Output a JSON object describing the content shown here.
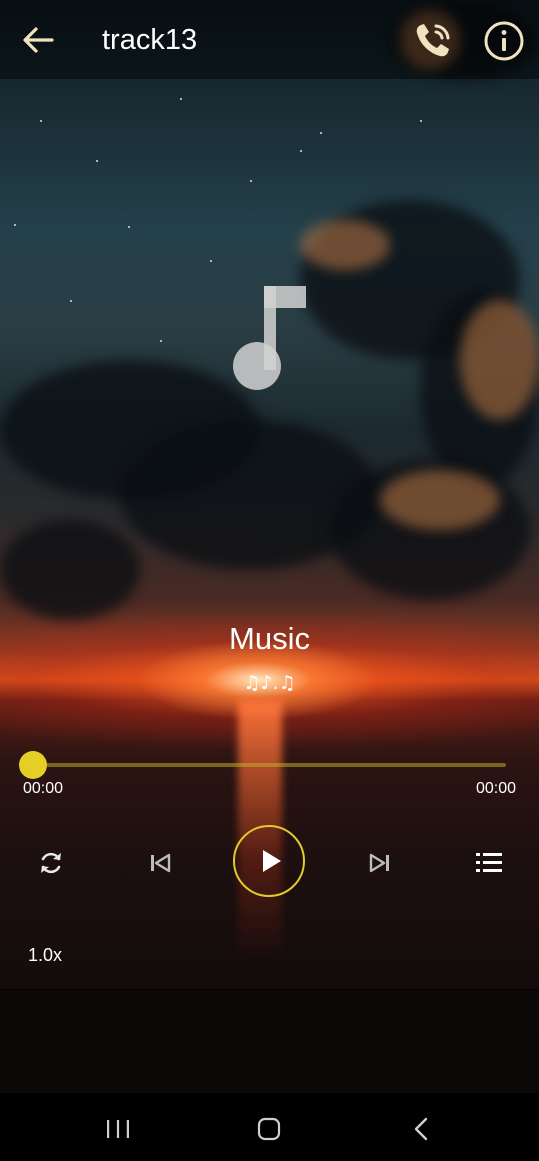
{
  "header": {
    "title": "track13",
    "back_icon": "arrow-left-icon",
    "call_icon": "phone-call-icon",
    "info_icon": "info-circle-icon"
  },
  "artwork": {
    "icon": "music-note-icon"
  },
  "track": {
    "title": "Music",
    "subtitle": "♫♪.♫"
  },
  "progress": {
    "current_time": "00:00",
    "total_time": "00:00",
    "fraction": 0.0
  },
  "controls": {
    "repeat_icon": "repeat-icon",
    "previous_icon": "skip-previous-icon",
    "play_icon": "play-icon",
    "next_icon": "skip-next-icon",
    "playlist_icon": "playlist-icon"
  },
  "speed": {
    "label": "1.0x"
  },
  "navbar": {
    "recents_icon": "recents-icon",
    "home_icon": "home-icon",
    "back_icon": "nav-back-icon"
  },
  "colors": {
    "accent": "#e3cf26",
    "text": "#ffffff",
    "topbar_bg": "rgba(0,0,0,0.45)",
    "navbar_bg": "#000000"
  }
}
